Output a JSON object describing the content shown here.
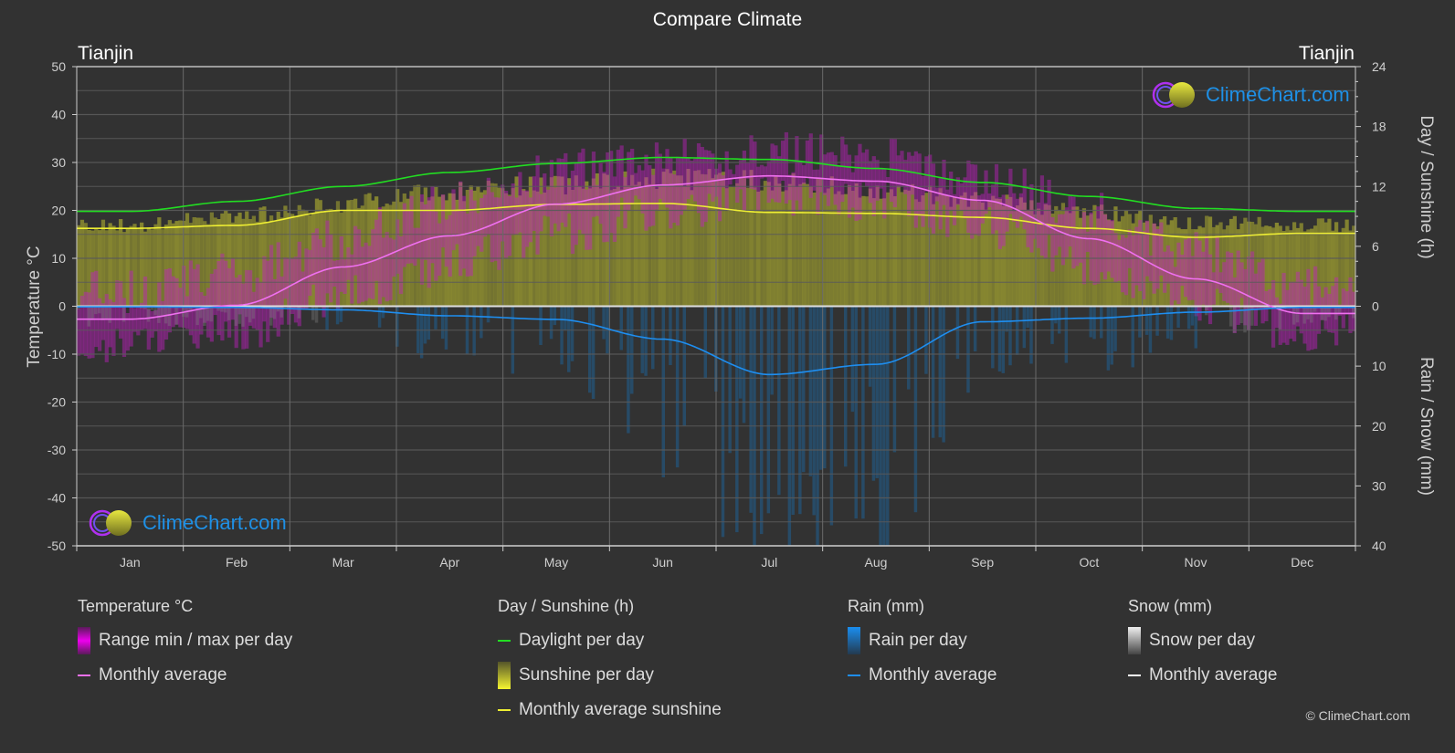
{
  "title": "Compare Climate",
  "city_left": "Tianjin",
  "city_right": "Tianjin",
  "logo_text": "ClimeChart.com",
  "copyright": "© ClimeChart.com",
  "colors": {
    "background": "#323232",
    "grid": "#5a5a5a",
    "temp_band": "#c020c0",
    "temp_avg": "#f070f0",
    "daylight": "#22dd22",
    "sunshine_band": "#a0a030",
    "sunshine_avg": "#eeee33",
    "rain_bar": "#1a6aa8",
    "rain_avg": "#1e8ef0",
    "snow_bar": "#888888",
    "snow_avg": "#ffffff",
    "logo_text": "#1e90e6"
  },
  "legend": {
    "temperature": {
      "title": "Temperature °C",
      "items": [
        {
          "label": "Range min / max per day",
          "swatch": "temp-range-swatch"
        },
        {
          "label": "Monthly average",
          "swatch": "temp-avg-swatch"
        }
      ]
    },
    "sunshine": {
      "title": "Day / Sunshine (h)",
      "items": [
        {
          "label": "Daylight per day",
          "swatch": "daylight-swatch"
        },
        {
          "label": "Sunshine per day",
          "swatch": "sunshine-swatch"
        },
        {
          "label": "Monthly average sunshine",
          "swatch": "sunshine-avg-swatch"
        }
      ]
    },
    "rain": {
      "title": "Rain (mm)",
      "items": [
        {
          "label": "Rain per day",
          "swatch": "rain-swatch"
        },
        {
          "label": "Monthly average",
          "swatch": "rain-avg-swatch"
        }
      ]
    },
    "snow": {
      "title": "Snow (mm)",
      "items": [
        {
          "label": "Snow per day",
          "swatch": "snow-swatch"
        },
        {
          "label": "Monthly average",
          "swatch": "snow-avg-swatch"
        }
      ]
    }
  },
  "chart_data": {
    "type": "line",
    "title": "Compare Climate",
    "location": "Tianjin",
    "categories": [
      "Jan",
      "Feb",
      "Mar",
      "Apr",
      "May",
      "Jun",
      "Jul",
      "Aug",
      "Sep",
      "Oct",
      "Nov",
      "Dec"
    ],
    "left_axis": {
      "label": "Temperature °C",
      "range": [
        -50,
        50
      ],
      "ticks": [
        50,
        40,
        30,
        20,
        10,
        0,
        -10,
        -20,
        -30,
        -40,
        -50
      ]
    },
    "right_axis_top": {
      "label": "Day / Sunshine (h)",
      "range": [
        0,
        24
      ],
      "ticks": [
        24,
        18,
        12,
        6,
        0
      ]
    },
    "right_axis_bottom": {
      "label": "Rain / Snow (mm)",
      "range": [
        0,
        40
      ],
      "ticks": [
        0,
        10,
        20,
        30,
        40
      ]
    },
    "grid": true,
    "series": [
      {
        "name": "Temperature monthly average",
        "unit": "°C",
        "values": [
          -2.7,
          0.2,
          8.2,
          14.7,
          21.3,
          25.3,
          27.2,
          26.1,
          22.1,
          14.1,
          5.7,
          -1.5
        ]
      },
      {
        "name": "Temperature daily max (approx)",
        "unit": "°C",
        "values": [
          3,
          7,
          14,
          22,
          28,
          31,
          32,
          31,
          27,
          20,
          11,
          4
        ]
      },
      {
        "name": "Temperature daily min (approx)",
        "unit": "°C",
        "values": [
          -8,
          -5,
          2,
          9,
          15,
          20,
          23,
          22,
          17,
          9,
          1,
          -6
        ]
      },
      {
        "name": "Daylight per day",
        "unit": "h",
        "values": [
          9.5,
          10.5,
          12.0,
          13.4,
          14.3,
          14.9,
          14.7,
          13.8,
          12.4,
          11.0,
          9.8,
          9.5
        ]
      },
      {
        "name": "Monthly average sunshine",
        "unit": "h",
        "values": [
          7.8,
          8.1,
          9.6,
          9.6,
          10.2,
          10.3,
          9.4,
          9.3,
          8.9,
          7.8,
          6.9,
          7.3
        ]
      },
      {
        "name": "Rain monthly average",
        "unit": "mm",
        "values": [
          0.1,
          0.2,
          0.6,
          1.6,
          2.2,
          5.5,
          11.4,
          9.7,
          2.6,
          2.0,
          1.0,
          0.2
        ]
      },
      {
        "name": "Snow monthly average",
        "unit": "mm",
        "values": [
          0.2,
          0.2,
          0.1,
          0,
          0,
          0,
          0,
          0,
          0,
          0,
          0.1,
          0.2
        ]
      }
    ]
  }
}
